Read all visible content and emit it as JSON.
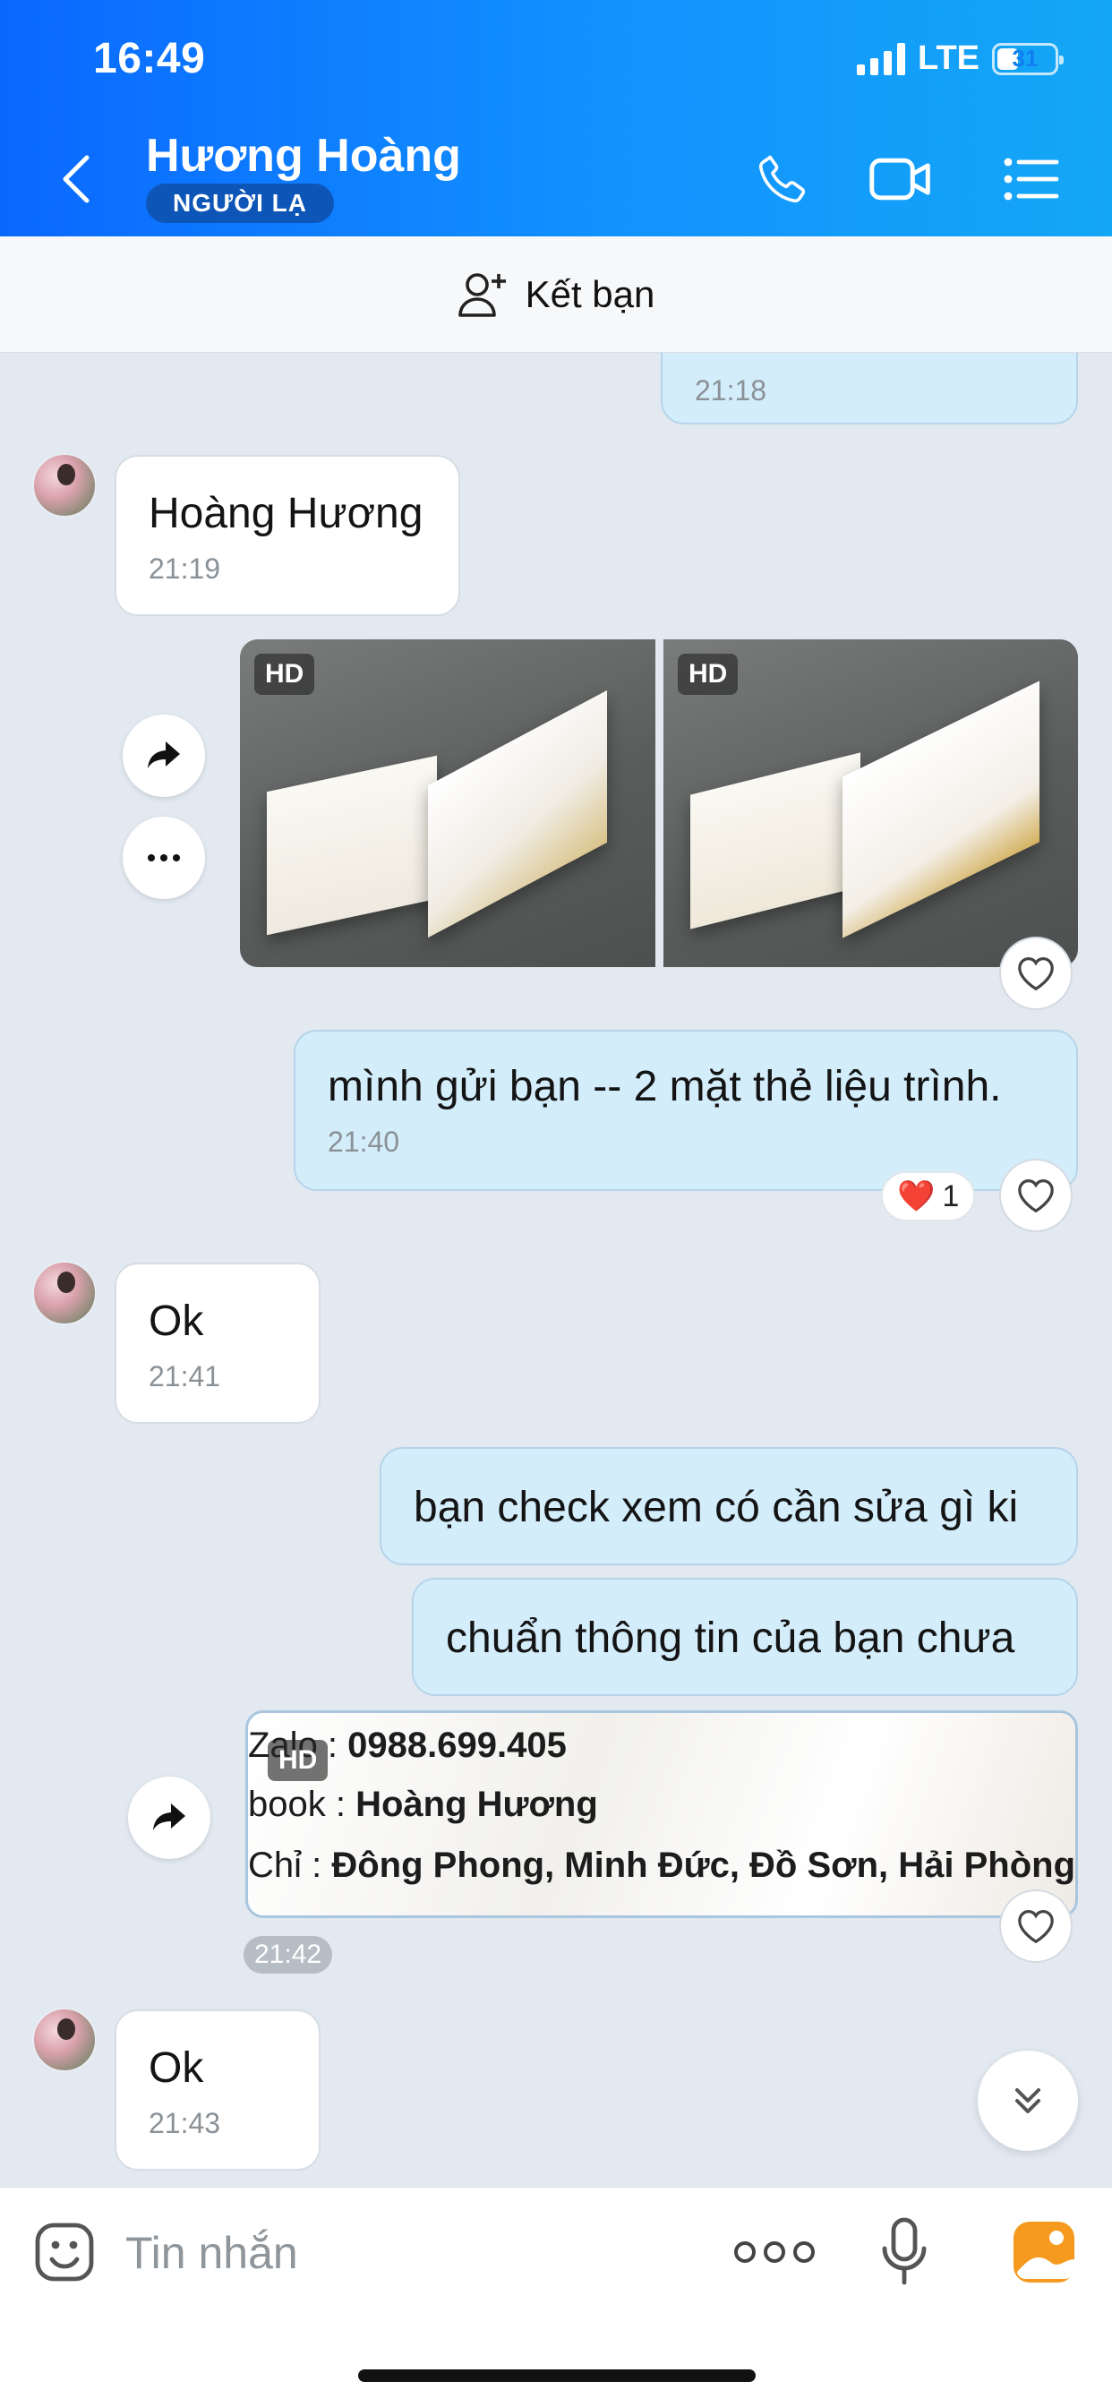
{
  "status_bar": {
    "time": "16:49",
    "network": "LTE",
    "battery": "31"
  },
  "header": {
    "contact_name": "Hương Hoàng",
    "badge": "NGƯỜI LẠ"
  },
  "add_friend": {
    "label": "Kết bạn"
  },
  "messages": [
    {
      "id": "m0",
      "direction": "out",
      "text": "",
      "time": "21:18"
    },
    {
      "id": "m1",
      "direction": "in",
      "text": "Hoàng Hương",
      "time": "21:19"
    },
    {
      "id": "m2",
      "direction": "out",
      "type": "images",
      "badges": [
        "HD",
        "HD"
      ]
    },
    {
      "id": "m3",
      "direction": "out",
      "text": "mình gửi bạn -- 2 mặt thẻ liệu trình.",
      "time": "21:40",
      "reaction": {
        "emoji": "❤️",
        "count": "1"
      }
    },
    {
      "id": "m4",
      "direction": "in",
      "text": "Ok",
      "time": "21:41"
    },
    {
      "id": "m5",
      "direction": "out",
      "text": "bạn check xem có cần sửa gì ki"
    },
    {
      "id": "m6",
      "direction": "out",
      "text": "chuẩn thông tin của bạn chưa"
    },
    {
      "id": "m7",
      "direction": "out",
      "type": "image",
      "badge": "HD",
      "time": "21:42",
      "image_lines": [
        {
          "lead": "Zalo : ",
          "value": "0988.699.405"
        },
        {
          "lead": "book : ",
          "value": "Hoàng Hương"
        },
        {
          "lead": "Chỉ : ",
          "value": "Đông Phong, Minh Đức, Đồ Sơn, Hải Phòng"
        }
      ]
    },
    {
      "id": "m8",
      "direction": "in",
      "text": "Ok",
      "time": "21:43"
    }
  ],
  "input": {
    "placeholder": "Tin nhắn"
  }
}
